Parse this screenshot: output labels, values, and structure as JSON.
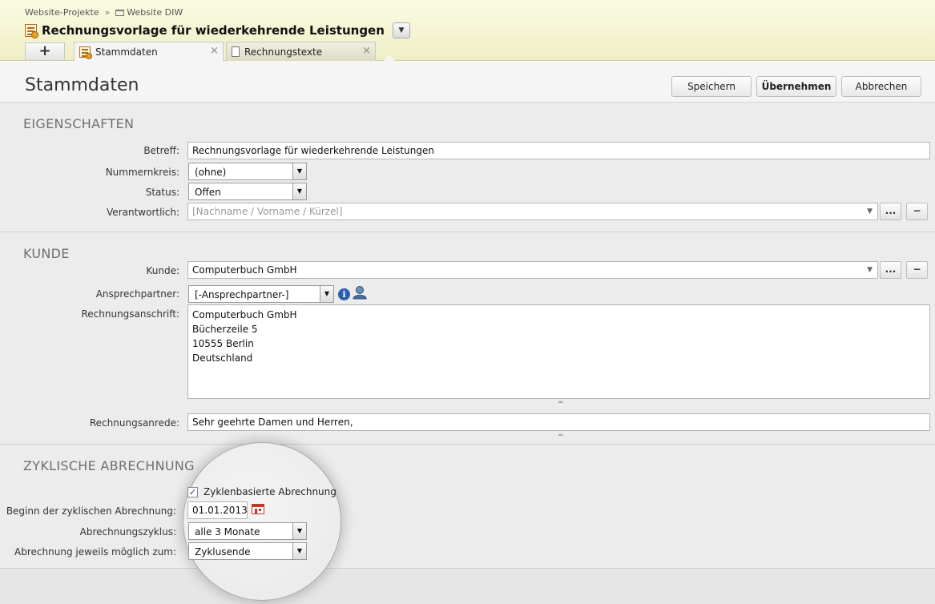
{
  "header": {
    "breadcrumb": [
      "Website-Projekte",
      "Website DIW"
    ],
    "breadcrumb_sep": "»",
    "title": "Rechnungsvorlage für wiederkehrende Leistungen",
    "title_dropdown_icon": "▼",
    "tabs": [
      {
        "label": "+"
      },
      {
        "label": "Stammdaten",
        "close": "×"
      },
      {
        "label": "Rechnungstexte",
        "close": "×"
      }
    ]
  },
  "toolbar": {
    "heading": "Stammdaten",
    "save_label": "Speichern",
    "apply_label": "Übernehmen",
    "cancel_label": "Abbrechen"
  },
  "eigenschaften": {
    "title": "EIGENSCHAFTEN",
    "betreff_label": "Betreff:",
    "betreff_value": "Rechnungsvorlage für wiederkehrende Leistungen",
    "nummernkreis_label": "Nummernkreis:",
    "nummernkreis_value": "(ohne)",
    "status_label": "Status:",
    "status_value": "Offen",
    "verantwortlich_label": "Verantwortlich:",
    "verantwortlich_placeholder": "[Nachname / Vorname / Kürzel]"
  },
  "kunde": {
    "title": "KUNDE",
    "kunde_label": "Kunde:",
    "kunde_value": "Computerbuch GmbH",
    "ansprechpartner_label": "Ansprechpartner:",
    "ansprechpartner_value": "[-Ansprechpartner-]",
    "rechnungsanschrift_label": "Rechnungsanschrift:",
    "rechnungsanschrift_lines": [
      "Computerbuch GmbH",
      "Bücherzeile 5",
      "10555 Berlin",
      "Deutschland"
    ],
    "rechnungsanrede_label": "Rechnungsanrede:",
    "rechnungsanrede_value": "Sehr geehrte Damen und Herren,"
  },
  "zyklisch": {
    "title": "ZYKLISCHE ABRECHNUNG",
    "checkbox_label": "Zyklenbasierte Abrechnung",
    "checkbox_checked": true,
    "beginn_label": "Beginn der zyklischen Abrechnung:",
    "beginn_value": "01.01.2013",
    "zyklus_label": "Abrechnungszyklus:",
    "zyklus_value": "alle 3 Monate",
    "moeglich_label": "Abrechnung jeweils möglich zum:",
    "moeglich_value": "Zyklusende"
  },
  "icons": {
    "more": "...",
    "remove": "−",
    "select_arrow": "▼",
    "check": "✓",
    "info": "i"
  }
}
